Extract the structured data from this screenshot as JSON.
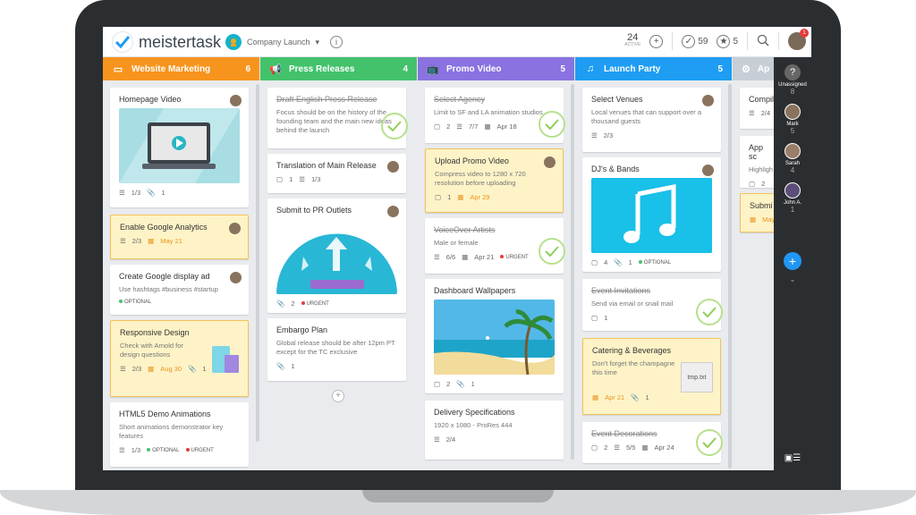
{
  "header": {
    "logo": "meistertask",
    "project": "Company Launch",
    "active_count": "24",
    "active_label": "ACTIVE",
    "done_count": "59",
    "star_count": "5",
    "notif_badge": "1",
    "info_label": "i"
  },
  "columns": [
    {
      "name": "Website Marketing",
      "count": "6",
      "icon": "monitor-icon",
      "color": "#f7941d",
      "cards": [
        {
          "title": "Homepage Video",
          "done": false,
          "image": "video-player",
          "checklist": "1/3",
          "attachments": "1"
        },
        {
          "title": "Enable Google Analytics",
          "yellow": true,
          "checklist": "2/3",
          "due": "May 21"
        },
        {
          "title": "Create Google display ad",
          "desc": "Use hashtags #business #startup",
          "tag1": "OPTIONAL"
        },
        {
          "title": "Responsive Design",
          "yellow": true,
          "desc": "Check with Arnold for design questions",
          "checklist": "2/3",
          "due": "Aug 30",
          "attachments": "1"
        },
        {
          "title": "HTML5 Demo Animations",
          "desc": "Short animations demonstrator key features",
          "checklist": "1/3",
          "tag1": "OPTIONAL",
          "tag2": "URGENT"
        }
      ]
    },
    {
      "name": "Press Releases",
      "count": "4",
      "icon": "megaphone-icon",
      "color": "#43c26b",
      "cards": [
        {
          "title": "Draft English Press Release",
          "done": true,
          "desc": "Focus should be on the history of the founding team and the main new ideas behind the launch"
        },
        {
          "title": "Translation of Main Release",
          "comments": "1",
          "checklist": "1/3"
        },
        {
          "title": "Submit to PR Outlets",
          "image": "upload-dome",
          "attachments": "2",
          "tag2": "URGENT"
        },
        {
          "title": "Embargo Plan",
          "desc": "Global release should be after 12pm PT except for the TC exclusive",
          "attachments": "1"
        }
      ],
      "add_label": "+"
    },
    {
      "name": "Promo Video",
      "count": "5",
      "icon": "tv-icon",
      "color": "#8a72e0",
      "cards": [
        {
          "title": "Select Agency",
          "done": true,
          "desc": "Limit to SF and LA animation studios",
          "comments": "2",
          "checklist": "7/7",
          "date": "Apr 18"
        },
        {
          "title": "Upload Promo Video",
          "yellow": true,
          "desc": "Compress video to 1280 x 720 resolution before uploading",
          "comments": "1",
          "due": "Apr 29"
        },
        {
          "title": "VoiceOver Artists",
          "done": true,
          "desc": "Male or female",
          "checklist": "6/6",
          "date": "Apr 21",
          "tag2": "URGENT"
        },
        {
          "title": "Dashboard Wallpapers",
          "image": "beach",
          "comments": "2",
          "attachments": "1"
        },
        {
          "title": "Delivery Specifications",
          "desc": "1920 x 1080 - ProRes 444",
          "checklist": "2/4"
        }
      ]
    },
    {
      "name": "Launch Party",
      "count": "5",
      "icon": "music-icon",
      "color": "#1e9df2",
      "cards": [
        {
          "title": "Select Venues",
          "desc": "Local venues that can support over a thousand guests",
          "checklist": "2/3"
        },
        {
          "title": "DJ's & Bands",
          "image": "music-note",
          "comments": "4",
          "attachments": "1",
          "tag1": "OPTIONAL"
        },
        {
          "title": "Event Invitations",
          "done": true,
          "desc": "Send via email or snail mail",
          "comments": "1"
        },
        {
          "title": "Catering & Beverages",
          "yellow": true,
          "desc": "Don't forget the champagne this time",
          "file": "tmp.txt",
          "due": "Apr 21",
          "attachments": "1"
        },
        {
          "title": "Event Decorations",
          "done": true,
          "comments": "2",
          "checklist": "5/5",
          "date": "Apr 24"
        }
      ]
    },
    {
      "name": "Ap",
      "icon": "app-icon",
      "color": "#c8ced6",
      "cards": [
        {
          "title": "Compil",
          "checklist": "2/4"
        },
        {
          "title": "App sc",
          "desc": "Highligh",
          "comments": "2"
        },
        {
          "title": "Submi",
          "yellow": true,
          "due": "May"
        }
      ]
    }
  ],
  "sidebar": {
    "help": "?",
    "users": [
      {
        "name": "Unassigned",
        "count": "8"
      },
      {
        "name": "Mark",
        "count": "5"
      },
      {
        "name": "Sarah",
        "count": "4"
      },
      {
        "name": "John A.",
        "count": "1"
      }
    ],
    "add": "+"
  }
}
